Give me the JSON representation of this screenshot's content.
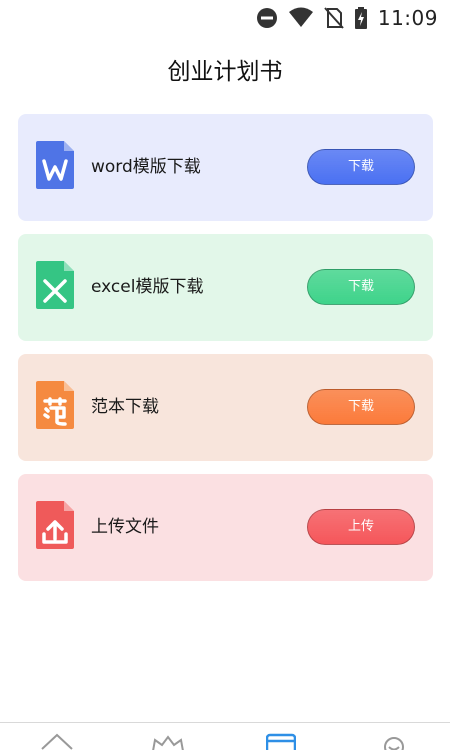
{
  "status_bar": {
    "time": "11:09",
    "icons": [
      "do-not-disturb-icon",
      "wifi-icon",
      "no-sim-icon",
      "battery-charging-icon"
    ]
  },
  "page": {
    "title": "创业计划书"
  },
  "cards": [
    {
      "label": "word模版下载",
      "button": "下载",
      "icon": "word-file-icon",
      "icon_glyph": "W",
      "bg": "#e8ebfd",
      "btn_color": "#4a70f2",
      "icon_color": "#4f74e6"
    },
    {
      "label": "excel模版下载",
      "button": "下载",
      "icon": "excel-file-icon",
      "icon_glyph": "X",
      "bg": "#e2f7e9",
      "btn_color": "#3ed38a",
      "icon_color": "#35c584"
    },
    {
      "label": "范本下载",
      "button": "下载",
      "icon": "template-file-icon",
      "icon_glyph": "范",
      "bg": "#f8e5dc",
      "btn_color": "#fb7a3a",
      "icon_color": "#f58a40"
    },
    {
      "label": "上传文件",
      "button": "上传",
      "icon": "upload-file-icon",
      "icon_glyph": "↑",
      "bg": "#fbe0e2",
      "btn_color": "#f5565a",
      "icon_color": "#ef5a5a"
    }
  ],
  "bottom_nav": {
    "items": [
      "home-icon",
      "crown-icon",
      "document-icon",
      "profile-icon"
    ],
    "active_index": 2,
    "active_color": "#2e8fe6"
  }
}
